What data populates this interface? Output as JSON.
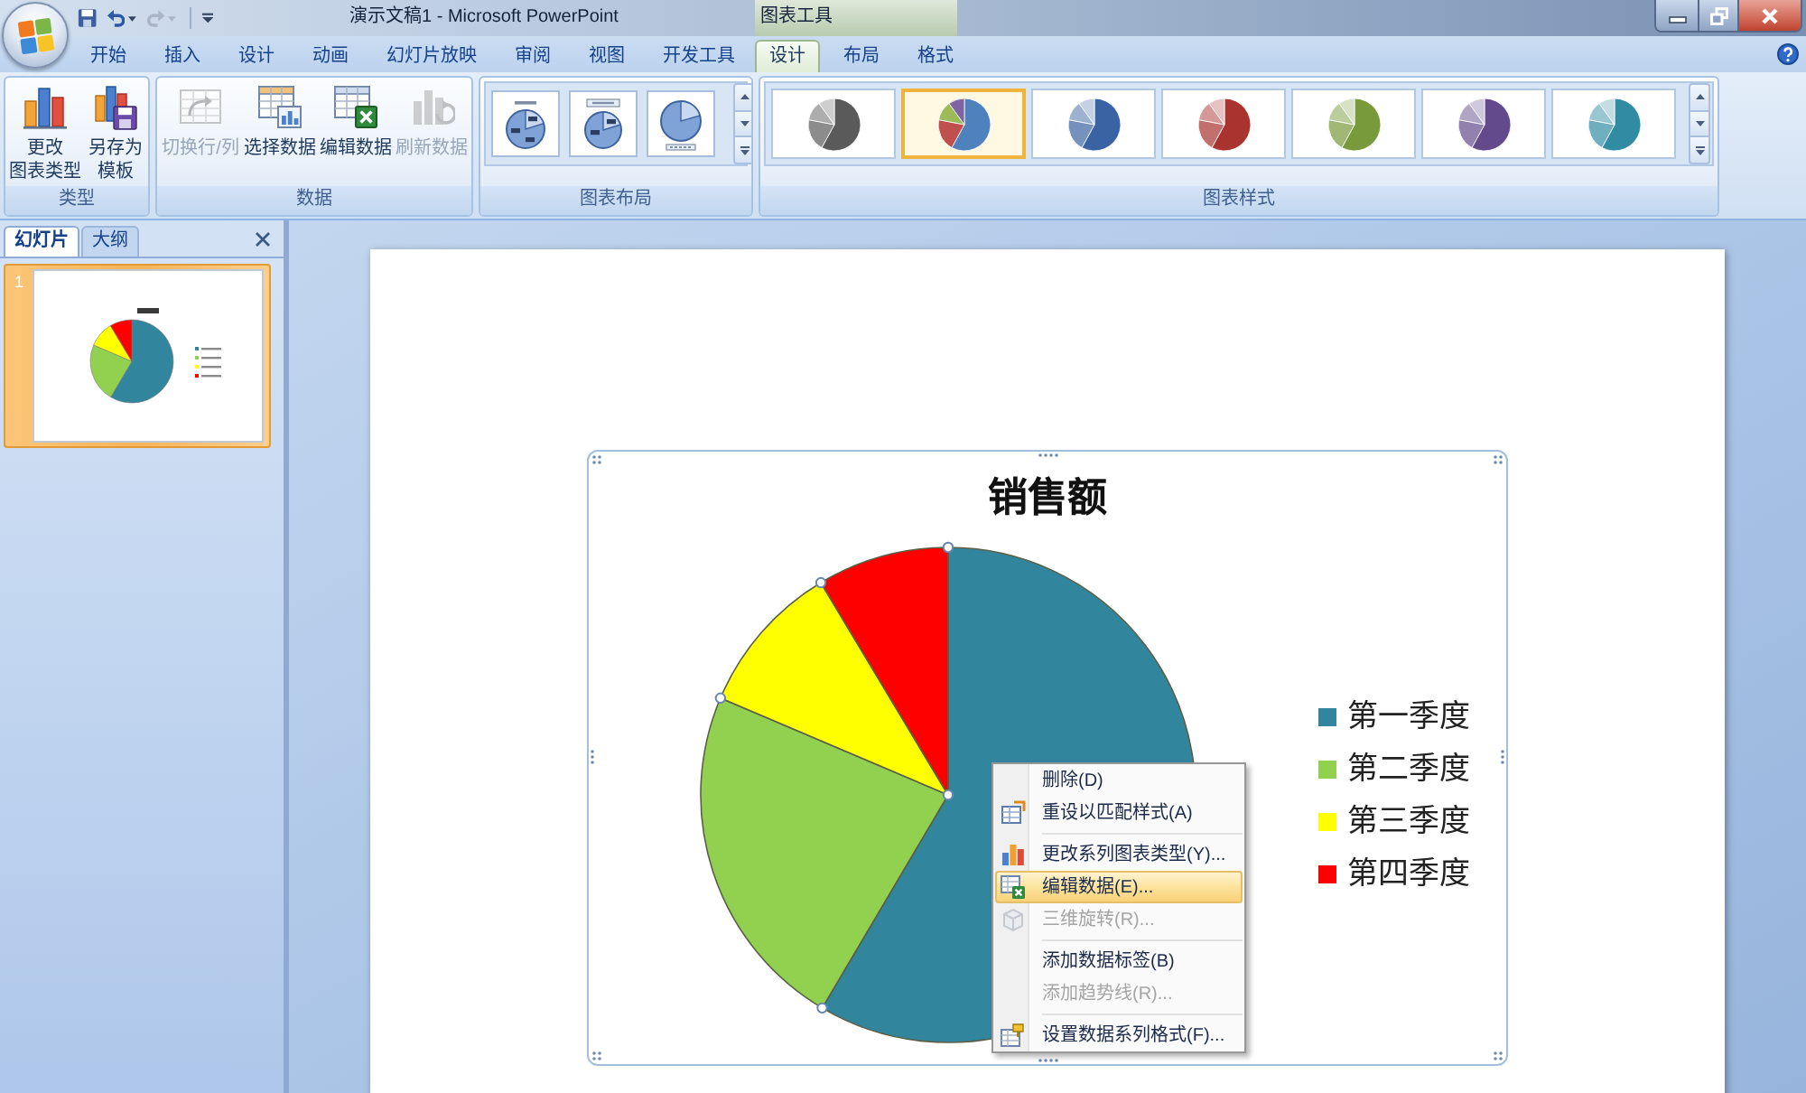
{
  "window": {
    "title": "演示文稿1 - Microsoft PowerPoint",
    "contextual_group": "图表工具"
  },
  "quick_access_toolbar": [
    {
      "kind": "save",
      "disabled": false
    },
    {
      "kind": "undo",
      "disabled": false
    },
    {
      "kind": "redo",
      "disabled": true
    }
  ],
  "ribbon_tabs": [
    {
      "label": "开始",
      "selected": false
    },
    {
      "label": "插入",
      "selected": false
    },
    {
      "label": "设计",
      "selected": false
    },
    {
      "label": "动画",
      "selected": false
    },
    {
      "label": "幻灯片放映",
      "selected": false
    },
    {
      "label": "审阅",
      "selected": false
    },
    {
      "label": "视图",
      "selected": false
    },
    {
      "label": "开发工具",
      "selected": false
    }
  ],
  "contextual_tabs": [
    {
      "label": "设计",
      "selected": true
    },
    {
      "label": "布局",
      "selected": false
    },
    {
      "label": "格式",
      "selected": false
    }
  ],
  "ribbon_groups": [
    {
      "kind": "buttons",
      "label": "类型",
      "buttons": [
        {
          "label_lines": [
            "更改",
            "图表类型"
          ],
          "disabled": false
        },
        {
          "label_lines": [
            "另存为",
            "模板"
          ],
          "disabled": false
        }
      ]
    },
    {
      "kind": "buttons",
      "label": "数据",
      "buttons": [
        {
          "label_lines": [
            "切换行/列"
          ],
          "disabled": true
        },
        {
          "label_lines": [
            "选择数据"
          ],
          "disabled": false
        },
        {
          "label_lines": [
            "编辑数据"
          ],
          "disabled": false
        },
        {
          "label_lines": [
            "刷新数据"
          ],
          "disabled": true
        }
      ]
    },
    {
      "kind": "layout_gallery",
      "label": "图表布局"
    },
    {
      "kind": "style_gallery",
      "label": "图表样式",
      "styles": [
        {
          "kind": "mono",
          "color": "#5a5a5a",
          "selected": false
        },
        {
          "kind": "multi",
          "color": "#4f81bd",
          "selected": true
        },
        {
          "kind": "mono",
          "color": "#3a63a3",
          "selected": false
        },
        {
          "kind": "mono",
          "color": "#a8332f",
          "selected": false
        },
        {
          "kind": "mono",
          "color": "#789a3a",
          "selected": false
        },
        {
          "kind": "mono",
          "color": "#634a8c",
          "selected": false
        },
        {
          "kind": "mono",
          "color": "#318ca3",
          "selected": false
        }
      ]
    }
  ],
  "slides_pane": {
    "tabs": [
      {
        "label": "幻灯片",
        "selected": true
      },
      {
        "label": "大纲",
        "selected": false
      }
    ],
    "slides": [
      {
        "number": "1",
        "selected": true
      }
    ]
  },
  "chart": {
    "selected": true,
    "series_selected": true,
    "chart_data": {
      "type": "pie",
      "title": "销售额",
      "categories": [
        "第一季度",
        "第二季度",
        "第三季度",
        "第四季度"
      ],
      "values": [
        58.5,
        22.9,
        10.0,
        8.6
      ],
      "colors": [
        "#31859c",
        "#92d050",
        "#ffff00",
        "#ff0000"
      ],
      "legend": "right"
    }
  },
  "context_menu": {
    "items": [
      {
        "kind": "command",
        "label": "删除(D)",
        "disabled": false,
        "selected": false
      },
      {
        "kind": "command",
        "label": "重设以匹配样式(A)",
        "disabled": false,
        "selected": false
      },
      {
        "kind": "separator"
      },
      {
        "kind": "command",
        "label": "更改系列图表类型(Y)...",
        "disabled": false,
        "selected": false
      },
      {
        "kind": "command",
        "label": "编辑数据(E)...",
        "disabled": false,
        "selected": true
      },
      {
        "kind": "command",
        "label": "三维旋转(R)...",
        "disabled": true,
        "selected": false
      },
      {
        "kind": "separator"
      },
      {
        "kind": "command",
        "label": "添加数据标签(B)",
        "disabled": false,
        "selected": false
      },
      {
        "kind": "command",
        "label": "添加趋势线(R)...",
        "disabled": true,
        "selected": false
      },
      {
        "kind": "separator"
      },
      {
        "kind": "command",
        "label": "设置数据系列格式(F)...",
        "disabled": false,
        "selected": false
      }
    ]
  }
}
